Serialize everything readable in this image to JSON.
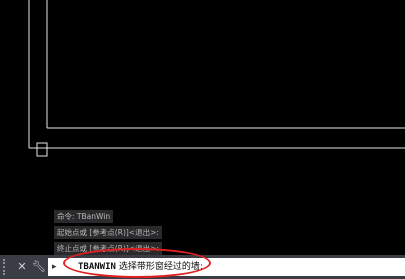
{
  "history": [
    "命令: TBanWin",
    "起始点或 [参考点(R)]<退出>:",
    "终止点或 [参考点(R)]<退出>:"
  ],
  "command_line": {
    "close_icon": "close-icon",
    "customize_icon": "wrench-icon",
    "prompt_icon": "chevron-right-icon",
    "command_name": "TBANWIN",
    "prompt_text": "选择带形窗经过的墙:"
  },
  "colors": {
    "canvas_bg": "#000000",
    "drawing_lines": "#e6e6e6",
    "highlight": "#e02020"
  }
}
